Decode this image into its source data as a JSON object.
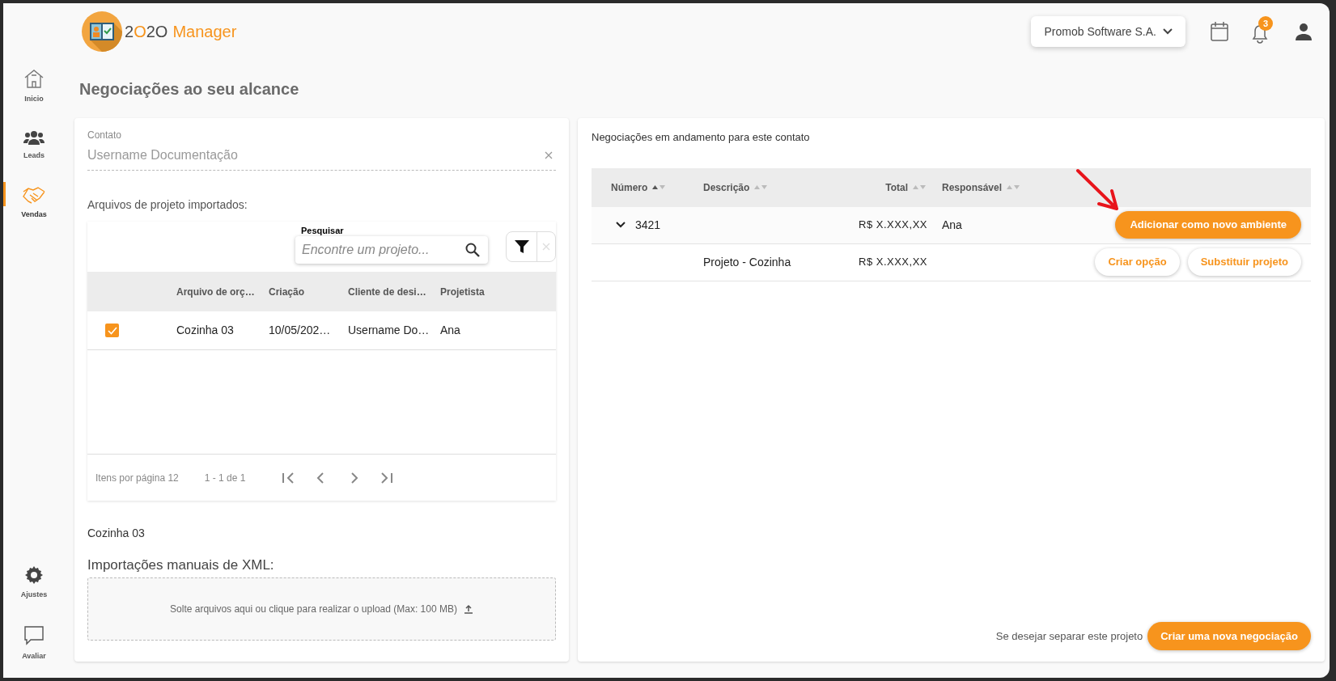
{
  "logo": {
    "parts": [
      {
        "text": "2",
        "accent": false
      },
      {
        "text": "O",
        "accent": true
      },
      {
        "text": "2O",
        "accent": false
      },
      {
        "text": "Manager",
        "accent": true
      }
    ]
  },
  "sidebar": {
    "items": [
      {
        "label": "Inicio",
        "selected": false
      },
      {
        "label": "Leads",
        "selected": false
      },
      {
        "label": "Vendas",
        "selected": true
      }
    ],
    "bottom_items": [
      {
        "label": "Ajustes",
        "selected": false
      },
      {
        "label": "Avaliar",
        "selected": false
      }
    ]
  },
  "header": {
    "company": "Promob Software S.A.",
    "notification_count": "3"
  },
  "title": "Negociações ao seu alcance",
  "left_panel": {
    "contact": {
      "label": "Contato",
      "value": "Username Documentação"
    },
    "imported_label": "Arquivos de projeto importados:",
    "search": {
      "label": "Pesquisar",
      "placeholder": "Encontre um projeto..."
    },
    "columns": [
      "Arquivo de orç…",
      "Criação",
      "Cliente de desi…",
      "Projetista"
    ],
    "rows": [
      {
        "checked": true,
        "cells": [
          "Cozinha 03",
          "10/05/202…",
          "Username Do…",
          "Ana"
        ]
      }
    ],
    "paginator": {
      "label": "Itens por página",
      "page_size": "12",
      "range": "1 - 1 de 1"
    },
    "selected_file": "Cozinha 03",
    "xml_label": "Importações manuais de XML:",
    "dropzone_text": "Solte arquivos aqui ou clique para realizar o upload (Max: 100 MB)"
  },
  "right_panel": {
    "caption": "Negociações em andamento para este contato",
    "columns": [
      {
        "label": "Número",
        "sorted": true
      },
      {
        "label": "Descrição",
        "sorted": false
      },
      {
        "label": "Total",
        "sorted": false
      },
      {
        "label": "Responsável",
        "sorted": false
      }
    ],
    "rows": [
      {
        "kind": "negotiation",
        "expanded": true,
        "number": "3421",
        "total": "R$ X.XXX,XX",
        "responsible": "Ana",
        "actions": [
          {
            "label": "Adicionar como novo ambiente",
            "primary": true
          }
        ]
      },
      {
        "kind": "project",
        "description": "Projeto - Cozinha",
        "total": "R$ X.XXX,XX",
        "actions": [
          {
            "label": "Criar opção",
            "primary": false
          },
          {
            "label": "Substituir projeto",
            "primary": false
          }
        ]
      }
    ],
    "footer_text": "Se desejar separar este projeto",
    "footer_button": "Criar uma nova negociação"
  }
}
